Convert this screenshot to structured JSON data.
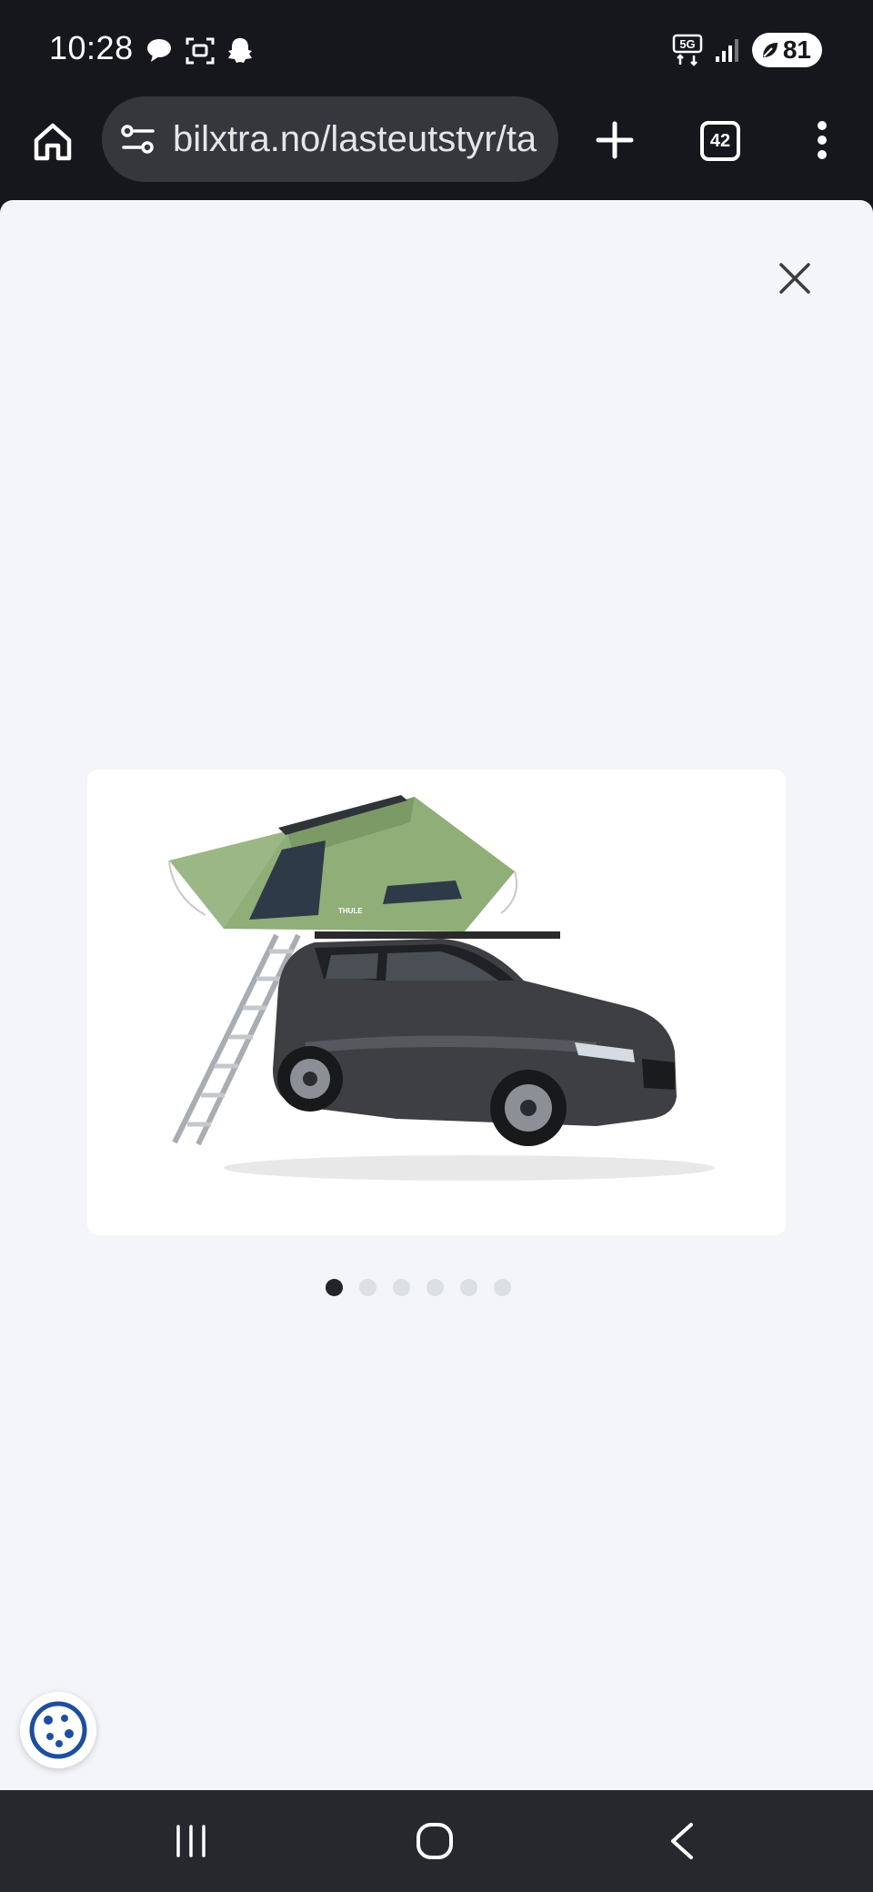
{
  "status_bar": {
    "time": "10:28",
    "notification_icons": [
      "chat-bubble-icon",
      "screenshot-icon",
      "snapchat-ghost-icon"
    ],
    "network": "5G",
    "battery": "81"
  },
  "browser": {
    "url": "bilxtra.no/lasteutstyr/ta",
    "tab_count": "42"
  },
  "gallery": {
    "image_alt": "Thule rooftop tent mounted on dark grey SUV with ladder",
    "tent_brand": "THULE",
    "total_images": 6,
    "active_index": 0
  },
  "colors": {
    "page_background": "#f3f5f8",
    "system_bar": "#15171c",
    "url_box": "#35373c",
    "dot_active": "#222428",
    "dot_inactive": "#dcdfe3",
    "cookie_icon": "#1d4fa0",
    "tent_green": "#8fae78",
    "car_grey": "#3d3f43"
  }
}
